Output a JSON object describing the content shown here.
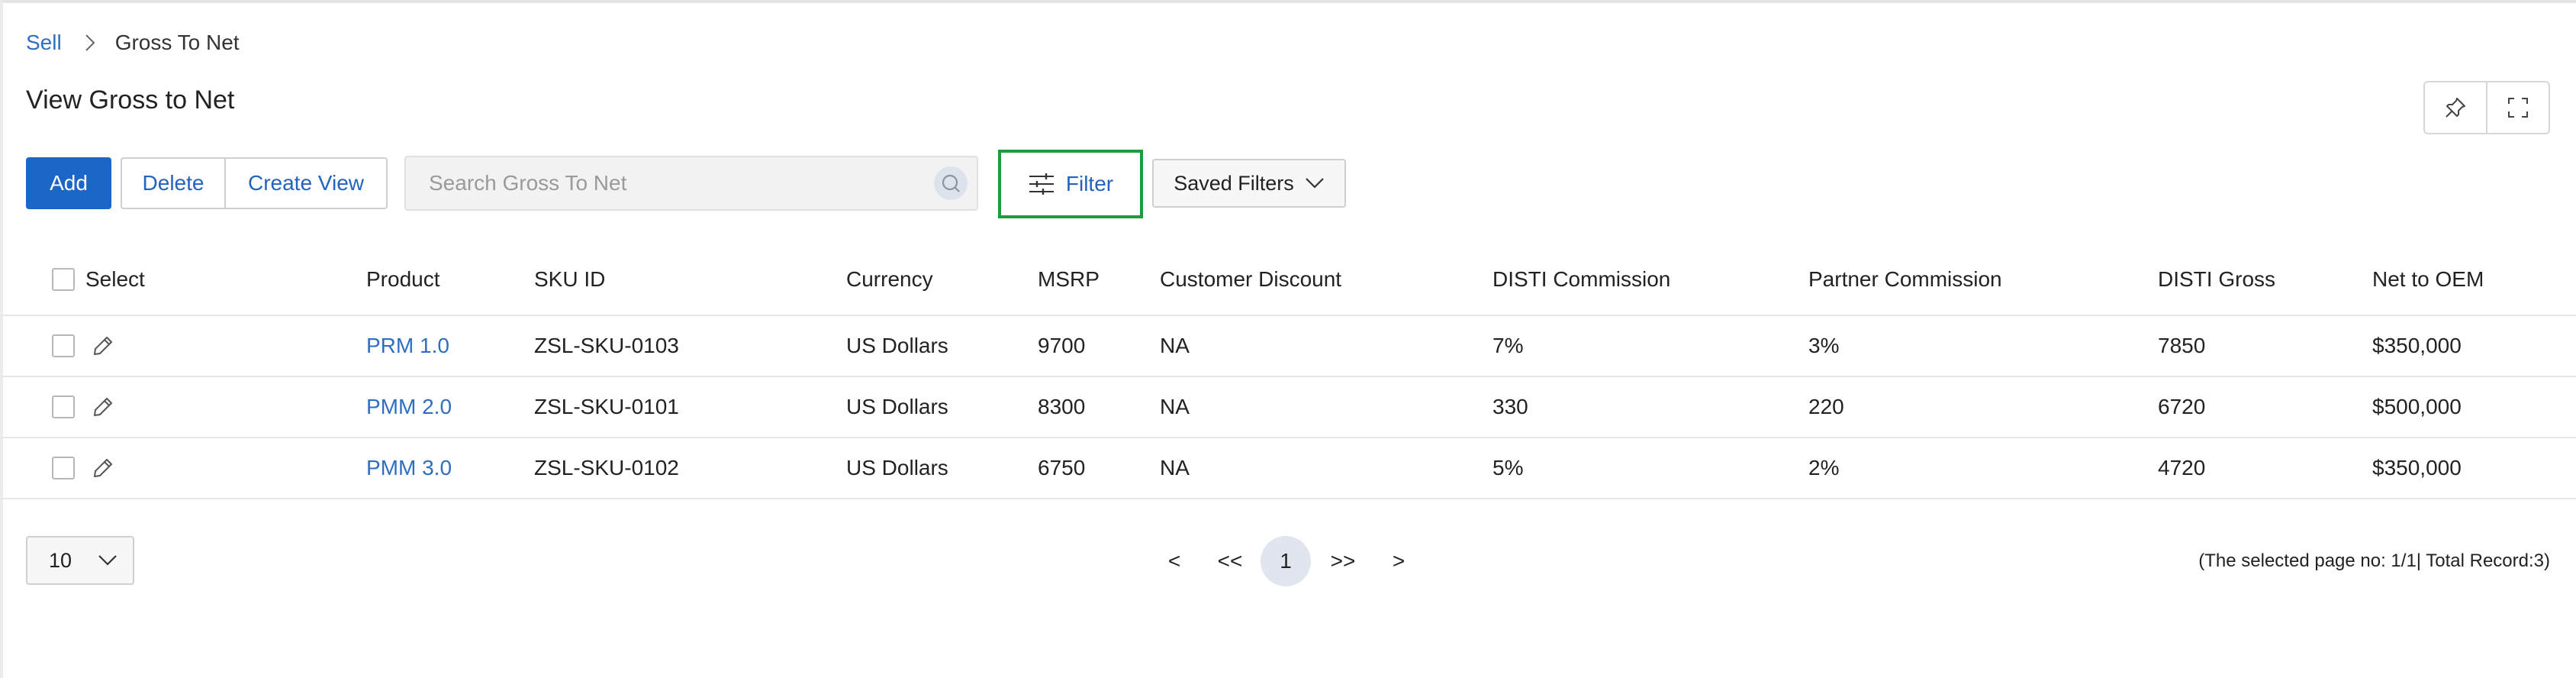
{
  "breadcrumb": {
    "root": "Sell",
    "current": "Gross To Net"
  },
  "page": {
    "title": "View Gross to Net"
  },
  "toolbar": {
    "add_label": "Add",
    "delete_label": "Delete",
    "create_view_label": "Create View",
    "search_placeholder": "Search Gross To Net",
    "filter_label": "Filter",
    "saved_filters_label": "Saved Filters"
  },
  "table": {
    "columns": [
      "Select",
      "Product",
      "SKU ID",
      "Currency",
      "MSRP",
      "Customer Discount",
      "DISTI Commission",
      "Partner Commission",
      "DISTI Gross",
      "Net to OEM"
    ],
    "rows": [
      {
        "product": "PRM 1.0",
        "sku": "ZSL-SKU-0103",
        "currency": "US Dollars",
        "msrp": "9700",
        "customer_discount": "NA",
        "disti_commission": "7%",
        "partner_commission": "3%",
        "disti_gross": "7850",
        "net_to_oem": "$350,000"
      },
      {
        "product": "PMM 2.0",
        "sku": "ZSL-SKU-0101",
        "currency": "US Dollars",
        "msrp": "8300",
        "customer_discount": "NA",
        "disti_commission": "330",
        "partner_commission": "220",
        "disti_gross": "6720",
        "net_to_oem": "$500,000"
      },
      {
        "product": "PMM 3.0",
        "sku": "ZSL-SKU-0102",
        "currency": "US Dollars",
        "msrp": "6750",
        "customer_discount": "NA",
        "disti_commission": "5%",
        "partner_commission": "2%",
        "disti_gross": "4720",
        "net_to_oem": "$350,000"
      }
    ]
  },
  "pagination": {
    "page_size": "10",
    "prev": "<",
    "first": "<<",
    "current_page": "1",
    "last": ">>",
    "next": ">",
    "info": "(The selected page no: 1/1| Total Record:3)"
  },
  "colors": {
    "accent": "#1a67c7",
    "link": "#2f6ec3",
    "filter_highlight": "#1f9b3a"
  },
  "icons": [
    "chevron-right-icon",
    "pin-icon",
    "fullscreen-icon",
    "search-icon",
    "filter-sliders-icon",
    "chevron-down-icon",
    "pencil-icon"
  ]
}
